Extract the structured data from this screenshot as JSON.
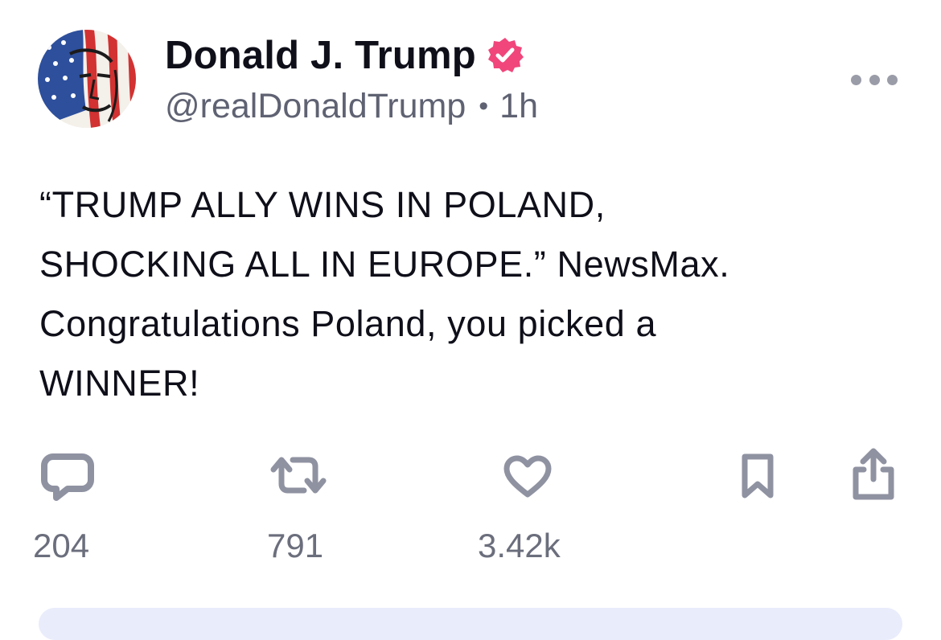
{
  "author": {
    "display_name": "Donald J. Trump",
    "handle": "@realDonaldTrump",
    "separator": "•",
    "time_ago": "1h",
    "avatar_icon": "flag-portrait-avatar",
    "verified_icon": "verified-badge-icon",
    "verified_color": "#f0467b"
  },
  "post": {
    "lines": [
      "“TRUMP ALLY WINS IN POLAND,",
      "SHOCKING ALL IN EUROPE.” NewsMax.",
      "Congratulations Poland, you picked a",
      "WINNER!"
    ]
  },
  "actions": {
    "reply": {
      "icon": "reply-icon",
      "count": "204"
    },
    "repost": {
      "icon": "repost-icon",
      "count": "791"
    },
    "like": {
      "icon": "heart-icon",
      "count": "3.42k"
    },
    "bookmark": {
      "icon": "bookmark-icon"
    },
    "share": {
      "icon": "share-icon"
    }
  },
  "colors": {
    "icon_gray": "#8f92a1",
    "text_dark": "#0f0f1a",
    "text_muted": "#5f6272"
  }
}
